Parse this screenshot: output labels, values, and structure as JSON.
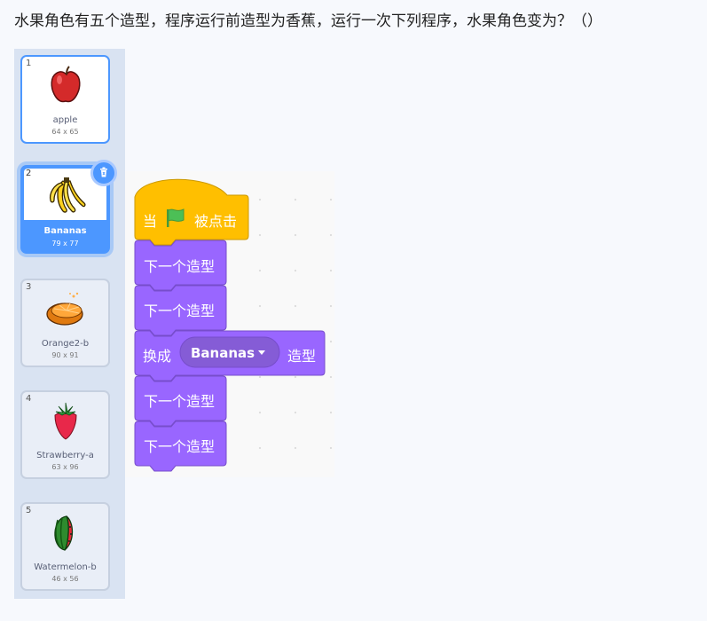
{
  "question": {
    "text": "水果角色有五个造型，程序运行前造型为香蕉，运行一次下列程序，水果角色变为？（）"
  },
  "costumes": [
    {
      "number": "1",
      "name": "apple",
      "size": "64 x 65",
      "icon": "apple-icon"
    },
    {
      "number": "2",
      "name": "Bananas",
      "size": "79 x 77",
      "icon": "banana-icon",
      "selected": true
    },
    {
      "number": "3",
      "name": "Orange2-b",
      "size": "90 x 91",
      "icon": "orange-icon"
    },
    {
      "number": "4",
      "name": "Strawberry-a",
      "size": "63 x 96",
      "icon": "strawberry-icon"
    },
    {
      "number": "5",
      "name": "Watermelon-b",
      "size": "46 x 56",
      "icon": "watermelon-icon"
    }
  ],
  "delete_icon": "trash-icon",
  "script": {
    "hat": {
      "prefix": "当",
      "flag_icon": "green-flag-icon",
      "suffix": "被点击"
    },
    "next1": "下一个造型",
    "next2": "下一个造型",
    "switch": {
      "prefix": "换成",
      "value": "Bananas",
      "suffix": "造型"
    },
    "next3": "下一个造型",
    "next4": "下一个造型"
  },
  "colors": {
    "events": "#ffbf00",
    "looks": "#9966ff",
    "looks_dark": "#855cd6",
    "selected": "#4c97ff",
    "flag": "#4cbf56"
  }
}
